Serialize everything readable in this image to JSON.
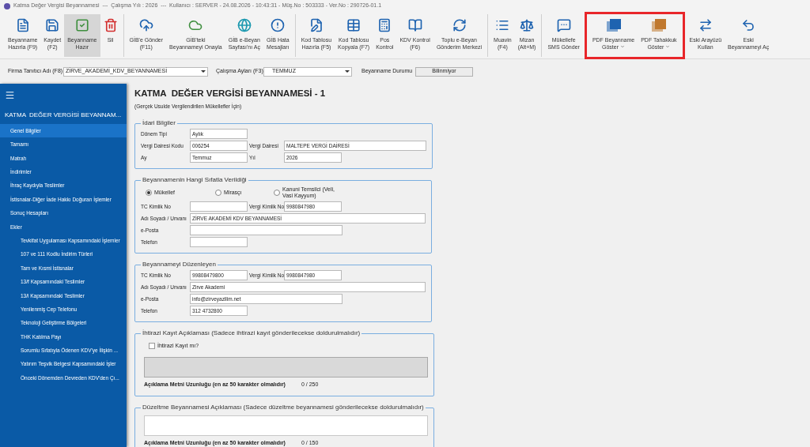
{
  "window": {
    "title": "Katma Değer Vergisi Beyannamesi  ---  Çalışma Yılı : 2026  ---  Kullanıcı : SERVER - 24.08.2026 - 10:43:31 - Müş.No : 503333 - Ver.No : 290726-01.1"
  },
  "toolbar": {
    "groups": [
      {
        "divider": true,
        "highlighted": false,
        "items": [
          {
            "lines": [
              "Beyanname",
              "Hazırla (F9)"
            ],
            "selected": false,
            "dropdown": false
          },
          {
            "lines": [
              "Kaydet",
              "(F2)"
            ],
            "selected": false,
            "dropdown": false
          },
          {
            "lines": [
              "Beyanname",
              "Hazır"
            ],
            "selected": true,
            "dropdown": false
          },
          {
            "lines": [
              "Sil"
            ],
            "selected": false,
            "dropdown": false
          }
        ]
      },
      {
        "divider": true,
        "highlighted": false,
        "items": [
          {
            "lines": [
              "GİB'e Gönder",
              "(F11)"
            ],
            "selected": false,
            "dropdown": false
          },
          {
            "lines": [
              "GİB'teki",
              "Beyannameyi Onayla"
            ],
            "selected": false,
            "dropdown": false
          },
          {
            "lines": [
              "GİB e-Beyan",
              "Sayfası'nı Aç"
            ],
            "selected": false,
            "dropdown": false
          },
          {
            "lines": [
              "GİB Hata",
              "Mesajları"
            ],
            "selected": false,
            "dropdown": false
          }
        ]
      },
      {
        "divider": true,
        "highlighted": false,
        "items": [
          {
            "lines": [
              "Kod Tablosu",
              "Hazırla (F5)"
            ],
            "selected": false,
            "dropdown": false
          },
          {
            "lines": [
              "Kod Tablosu",
              "Kopyala (F7)"
            ],
            "selected": false,
            "dropdown": false
          },
          {
            "lines": [
              "Pos",
              "Kontrol"
            ],
            "selected": false,
            "dropdown": false
          },
          {
            "lines": [
              "KDV Kontrol",
              "(F6)"
            ],
            "selected": false,
            "dropdown": false
          },
          {
            "lines": [
              "Toplu e-Beyan",
              "Gönderim Merkezi"
            ],
            "selected": false,
            "dropdown": false
          }
        ]
      },
      {
        "divider": true,
        "highlighted": false,
        "items": [
          {
            "lines": [
              "Muavin",
              "(F4)"
            ],
            "selected": false,
            "dropdown": false
          },
          {
            "lines": [
              "Mizan",
              "(Alt+M)"
            ],
            "selected": false,
            "dropdown": false
          }
        ]
      },
      {
        "divider": false,
        "highlighted": false,
        "items": [
          {
            "lines": [
              "Mükellefe",
              "SMS Gönder"
            ],
            "selected": false,
            "dropdown": false
          }
        ]
      },
      {
        "divider": false,
        "highlighted": true,
        "items": [
          {
            "lines": [
              "PDF Beyanname",
              "Göster"
            ],
            "selected": false,
            "dropdown": true
          },
          {
            "lines": [
              "PDF Tahakkuk",
              "Göster"
            ],
            "selected": false,
            "dropdown": true
          }
        ]
      },
      {
        "divider": false,
        "highlighted": false,
        "items": [
          {
            "lines": [
              "Eski Arayüzü",
              "Kullan"
            ],
            "selected": false,
            "dropdown": false
          },
          {
            "lines": [
              "Eski",
              "Beyannameyi Aç"
            ],
            "selected": false,
            "dropdown": false
          }
        ]
      }
    ]
  },
  "filters": {
    "company_label": "Firma Tanıtıcı Adı (F8)",
    "company_value": "ZİRVE_AKADEMİ_KDV_BEYANNAMESİ",
    "months_label": "Çalışma Ayları (F3)",
    "months_value": "TEMMUZ",
    "status_label": "Beyanname Durumu",
    "status_value": "Bilinmiyor"
  },
  "sidebar": {
    "title": "KATMA  DEĞER VERGİSİ BEYANNAM...",
    "items": [
      {
        "label": "Genel Bilgiler",
        "selected": true
      },
      {
        "label": "Tamamı",
        "selected": false
      },
      {
        "label": "Matrah",
        "selected": false
      },
      {
        "label": "İndirimler",
        "selected": false
      },
      {
        "label": "İhraç Kaydıyla Teslimler",
        "selected": false
      },
      {
        "label": "İstisnalar-Diğer İade Hakkı Doğuran İşlemler",
        "selected": false
      },
      {
        "label": "Sonuç Hesapları",
        "selected": false
      },
      {
        "label": "Ekler",
        "selected": false,
        "children": [
          {
            "label": "Tevkifat Uygulaması Kapsamındaki İşlemler",
            "selected": false
          },
          {
            "label": "107 ve 111 Kodlu İndirim Türleri",
            "selected": false
          },
          {
            "label": "Tam ve Kısmi İstisnalar",
            "selected": false
          },
          {
            "label": "13/f Kapsamındaki Teslimler",
            "selected": false
          },
          {
            "label": "13/i Kapsamındaki Teslimler",
            "selected": false
          },
          {
            "label": "Yenilenmiş Cep Telefonu",
            "selected": false
          },
          {
            "label": "Teknoloji Geliştirme Bölgeleri",
            "selected": false
          },
          {
            "label": "THK Katılma Payı",
            "selected": false
          },
          {
            "label": "Sorumlu Sıfatıyla Ödenen KDV'ye İlişkin ...",
            "selected": false
          },
          {
            "label": "Yatırım Teşvik Belgesi Kapsamındaki İşler",
            "selected": false
          },
          {
            "label": "Önceki Dönemden Devreden KDV'den Çı...",
            "selected": false
          }
        ]
      }
    ]
  },
  "form": {
    "title": "KATMA  DEĞER VERGİSİ BEYANNAMESİ - 1",
    "subtitle": "(Gerçek Usulde Vergilendirilen Mükellefler İçin)",
    "sections": [
      {
        "kind": "fields",
        "legend": "İdari Bilgiler",
        "rows": [
          [
            {
              "label": "Dönem Tipi",
              "value": "Aylık"
            }
          ],
          [
            {
              "label": "Vergi Dairesi Kodu",
              "value": "006254"
            },
            {
              "label": "Vergi Dairesi",
              "value": "MALTEPE VERGİ DAİRESİ"
            }
          ],
          [
            {
              "label": "Ay",
              "value": "Temmuz"
            },
            {
              "label": "Yıl",
              "value": "2026"
            }
          ]
        ]
      },
      {
        "kind": "fields",
        "legend": "Beyannamenin Hangi Sıfatla Verildiği",
        "radios": [
          {
            "label": "Mükellef",
            "selected": true
          },
          {
            "label": "Mirasçı",
            "selected": false
          },
          {
            "label": "Kanuni Temsilci (Veli, Vasi Kayyum)",
            "selected": false
          }
        ],
        "rows": [
          [
            {
              "label": "TC Kimlik No"
            },
            {
              "label": "Vergi Kimlik No",
              "value": "9980847980"
            }
          ],
          [
            {
              "label": "Adı Soyadı / Unvanı",
              "value": "ZİRVE AKADEMİ KDV BEYANNAMESİ"
            }
          ],
          [
            {
              "label": "e-Posta"
            }
          ],
          [
            {
              "label": "Telefon"
            }
          ]
        ]
      },
      {
        "kind": "fields",
        "legend": "Beyannameyi Düzenleyen",
        "rows": [
          [
            {
              "label": "TC Kimlik No",
              "value": "99808479800"
            },
            {
              "label": "Vergi Kimlik No",
              "value": "9980847980"
            }
          ],
          [
            {
              "label": "Adı Soyadı / Unvanı",
              "value": "Zirve Akademi"
            }
          ],
          [
            {
              "label": "e-Posta",
              "value": "info@zirveyazilim.net"
            }
          ],
          [
            {
              "label": "Telefon",
              "value": "312 4732800"
            }
          ]
        ]
      },
      {
        "kind": "note",
        "legend": "İhtirazi Kayıt Açıklaması (Sadece ihtirazi kayıt gönderilecekse doldurulmalıdır)",
        "checkbox": {
          "label": "İhtirazi Kayıt mı?",
          "checked": false
        },
        "disabled": true,
        "length_label": "Açıklama Metni Uzunluğu (en az 50 karakter olmalıdır)",
        "count": "0 / 250"
      },
      {
        "kind": "note",
        "legend": "Düzeltme Beyannamesi Açıklaması (Sadece düzeltme beyannamesi gönderilecekse doldurulmalıdır)",
        "disabled": false,
        "length_label": "Açıklama Metni Uzunluğu (en az 50 karakter olmalıdır)",
        "count": "0 / 150"
      }
    ]
  }
}
